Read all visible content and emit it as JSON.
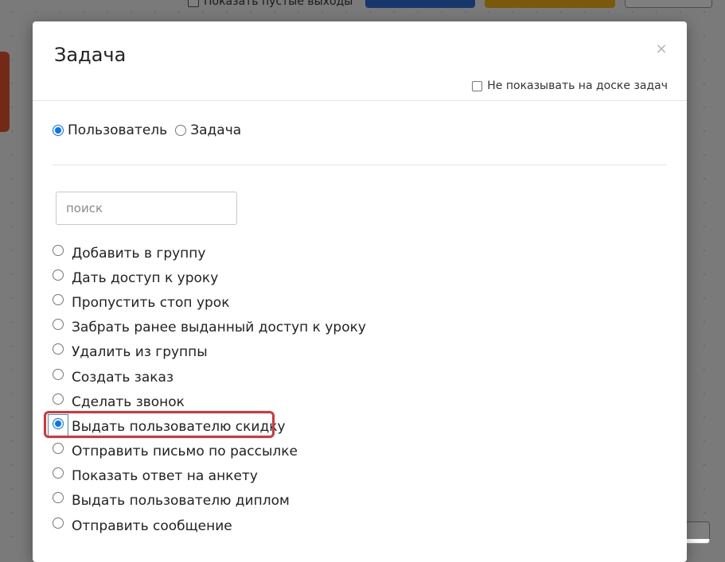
{
  "background": {
    "toolbar_checkbox_label": "Показать пустые выходы"
  },
  "modal": {
    "title": "Задача",
    "close_symbol": "×",
    "hide_on_board_label": "Не показывать на доске задач",
    "type_options": [
      {
        "label": "Пользователь",
        "checked": true
      },
      {
        "label": "Задача",
        "checked": false
      }
    ],
    "search": {
      "placeholder": "поиск",
      "value": ""
    },
    "actions": [
      {
        "label": "Добавить в группу",
        "checked": false
      },
      {
        "label": "Дать доступ к уроку",
        "checked": false
      },
      {
        "label": "Пропустить стоп урок",
        "checked": false
      },
      {
        "label": "Забрать ранее выданный доступ к уроку",
        "checked": false
      },
      {
        "label": "Удалить из группы",
        "checked": false
      },
      {
        "label": "Создать заказ",
        "checked": false
      },
      {
        "label": "Сделать звонок",
        "checked": false
      },
      {
        "label": "Выдать пользователю скидку",
        "checked": true
      },
      {
        "label": "Отправить письмо по рассылке",
        "checked": false
      },
      {
        "label": "Показать ответ на анкету",
        "checked": false
      },
      {
        "label": "Выдать пользователю диплом",
        "checked": false
      },
      {
        "label": "Отправить сообщение",
        "checked": false
      }
    ]
  },
  "colors": {
    "radio_accent": "#0075ff",
    "highlight": "#d8343a",
    "overlay": "rgba(0,0,0,0.5)"
  }
}
